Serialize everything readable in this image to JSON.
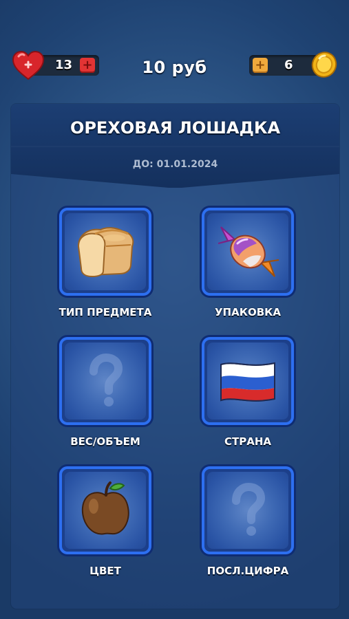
{
  "hud": {
    "lives": "13",
    "coins": "6",
    "currency": "10 руб"
  },
  "card": {
    "title": "ОРЕХОВАЯ ЛОШАДКА",
    "date": "ДО: 01.01.2024"
  },
  "hints": [
    {
      "label": "ТИП ПРЕДМЕТА",
      "icon": "bread-icon"
    },
    {
      "label": "УПАКОВКА",
      "icon": "candy-icon"
    },
    {
      "label": "ВЕС/ОБЪЕМ",
      "icon": "question-icon"
    },
    {
      "label": "СТРАНА",
      "icon": "russia-flag-icon"
    },
    {
      "label": "ЦВЕТ",
      "icon": "brown-apple-icon"
    },
    {
      "label": "ПОСЛ.ЦИФРА",
      "icon": "question-icon"
    }
  ],
  "colors": {
    "background": "#2e5788",
    "tile_border": "#2d6ff0",
    "plus_red": "#e23434",
    "plus_orange": "#f0a93c"
  }
}
